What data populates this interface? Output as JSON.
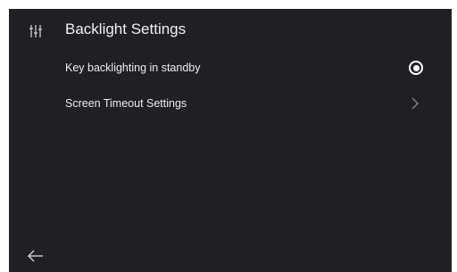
{
  "header": {
    "icon": "equalizer-sliders-icon",
    "title": "Backlight Settings"
  },
  "items": [
    {
      "label": "Key backlighting in standby",
      "control": "radio",
      "selected": true
    },
    {
      "label": "Screen Timeout Settings",
      "control": "chevron-right-icon"
    }
  ],
  "footer": {
    "back_icon": "back-arrow-icon"
  },
  "colors": {
    "background": "#202024",
    "text": "#ececec",
    "chevron": "#8c8c8c"
  }
}
